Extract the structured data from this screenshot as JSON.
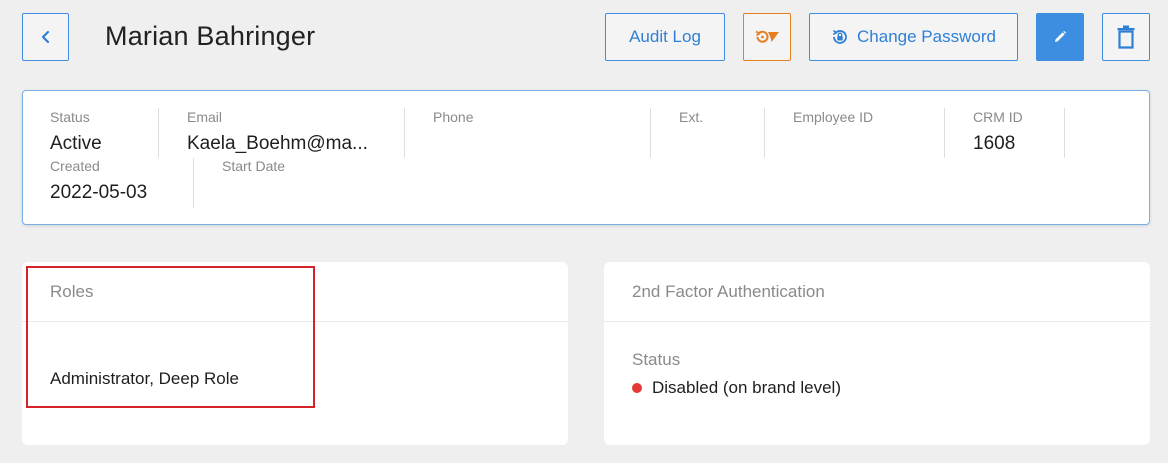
{
  "header": {
    "title": "Marian Bahringer",
    "audit_log_label": "Audit Log",
    "change_password_label": "Change Password"
  },
  "info": {
    "status_label": "Status",
    "status_value": "Active",
    "email_label": "Email",
    "email_value": "Kaela_Boehm@ma...",
    "phone_label": "Phone",
    "phone_value": "",
    "ext_label": "Ext.",
    "ext_value": "",
    "employee_id_label": "Employee ID",
    "employee_id_value": "",
    "crm_id_label": "CRM ID",
    "crm_id_value": "1608",
    "created_label": "Created",
    "created_value": "2022-05-03",
    "start_date_label": "Start Date",
    "start_date_value": ""
  },
  "roles": {
    "title": "Roles",
    "value": "Administrator, Deep Role"
  },
  "two_factor": {
    "title": "2nd Factor Authentication",
    "status_label": "Status",
    "status_value": "Disabled (on brand level)",
    "status_color": "#e53935"
  },
  "colors": {
    "accent": "#3d8de0",
    "sso_accent": "#e67e22",
    "highlight": "#d6232a"
  }
}
